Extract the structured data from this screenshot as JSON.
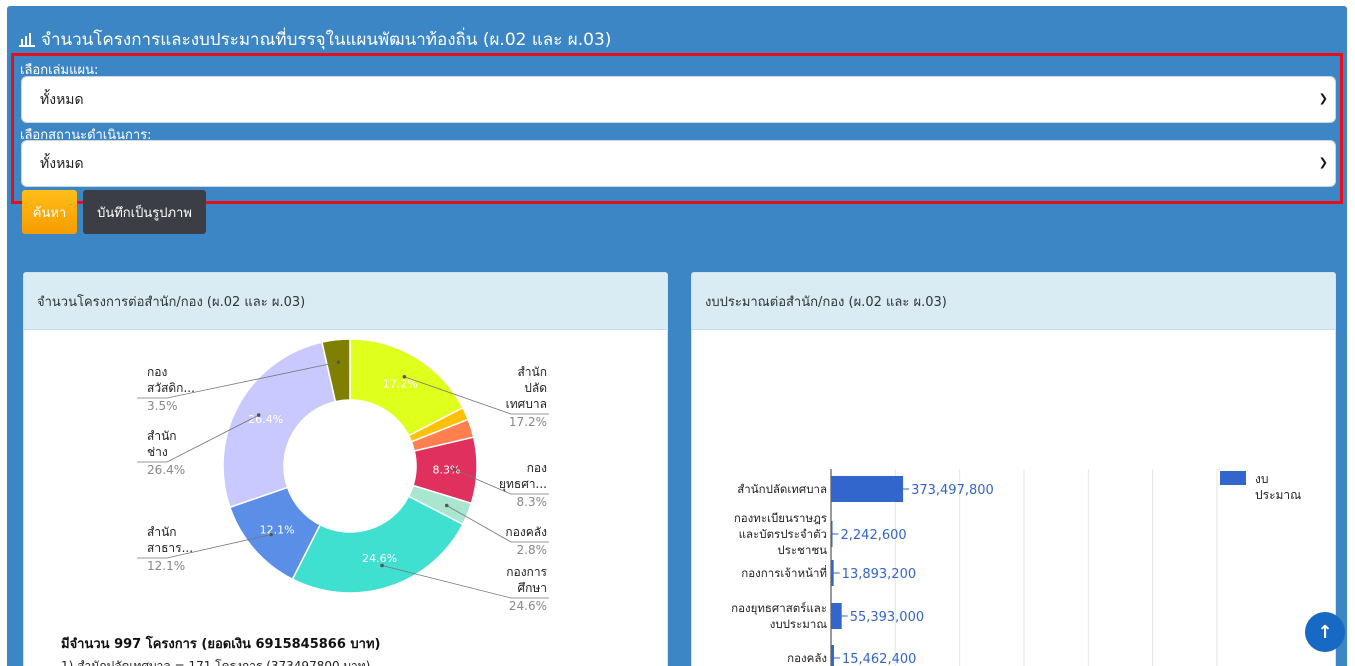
{
  "header": {
    "title": "จำนวนโครงการและงบประมาณที่บรรจุในแผนพัฒนาท้องถิ่น (ผ.02 และ ผ.03)",
    "icon": "bar-chart-icon",
    "color": "#3d86c6"
  },
  "filters": {
    "plan_label": "เลือกเล่มแผน:",
    "plan_value": "ทั้งหมด",
    "status_label": "เลือกสถานะดำเนินการ:",
    "status_value": "ทั้งหมด"
  },
  "buttons": {
    "search": "ค้นหา",
    "save_image": "บันทึกเป็นรูปภาพ"
  },
  "left_card": {
    "title": "จำนวนโครงการต่อสำนัก/กอง (ผ.02 และ ผ.03)"
  },
  "right_card": {
    "title": "งบประมาณต่อสำนัก/กอง (ผ.02 และ ผ.03)"
  },
  "summary": {
    "total": "มีจำนวน 997 โครงการ (ยอดเงิน 6915845866 บาท)",
    "line1": "1) สำนักปลัดเทศบาล = 171 โครงการ (373497800 บาท)"
  },
  "chart_data": [
    {
      "type": "pie",
      "slices": [
        {
          "label": [
            "สำนัก",
            "ปลัด",
            "เทศบาล"
          ],
          "pct_label": "17.2%",
          "value": 17.2,
          "inner": "17.2%",
          "color": "#dfff1d"
        },
        {
          "label": [],
          "pct_label": "",
          "value": 1.6,
          "inner": "",
          "color": "#ffc107"
        },
        {
          "label": [],
          "pct_label": "",
          "value": 2.3,
          "inner": "",
          "color": "#ff7f4e"
        },
        {
          "label": [
            "กอง",
            "ยุทธศา..."
          ],
          "pct_label": "8.3%",
          "value": 8.3,
          "inner": "8.3%",
          "color": "#e0305e"
        },
        {
          "label": [
            "กองคลัง"
          ],
          "pct_label": "2.8%",
          "value": 2.8,
          "inner": "",
          "color": "#a8e6cf"
        },
        {
          "label": [
            "กองการ",
            "ศึกษา"
          ],
          "pct_label": "24.6%",
          "value": 24.6,
          "inner": "24.6%",
          "color": "#40e0d0"
        },
        {
          "label": [
            "สำนัก",
            "สาธาร..."
          ],
          "pct_label": "12.1%",
          "value": 12.1,
          "inner": "12.1%",
          "color": "#5b8ee6"
        },
        {
          "label": [
            "สำนัก",
            "ช่าง"
          ],
          "pct_label": "26.4%",
          "value": 26.4,
          "inner": "26.4%",
          "color": "#c9c9ff"
        },
        {
          "label": [
            "กอง",
            "สวัสดิก..."
          ],
          "pct_label": "3.5%",
          "value": 3.5,
          "inner": "",
          "color": "#7f8000"
        }
      ]
    },
    {
      "type": "bar",
      "orientation": "horizontal",
      "categories": [
        [
          "สำนักปลัดเทศบาล"
        ],
        [
          "กองทะเบียนราษฎร",
          "และบัตรประจำตัว",
          "ประชาชน"
        ],
        [
          "กองการเจ้าหน้าที่"
        ],
        [
          "กองยุทธศาสตร์และ",
          "งบประมาณ"
        ],
        [
          "กองคลัง"
        ]
      ],
      "values": [
        373497800,
        2242600,
        13893200,
        55393000,
        15462400
      ],
      "value_labels": [
        "373,497,800",
        "2,242,600",
        "13,893,200",
        "55,393,000",
        "15,462,400"
      ],
      "series": [
        {
          "name": "งบประมาณ",
          "legend_lines": [
            "งบ",
            "ประมาณ"
          ],
          "color": "#3366cc"
        }
      ],
      "xmax": 2000000000
    }
  ]
}
